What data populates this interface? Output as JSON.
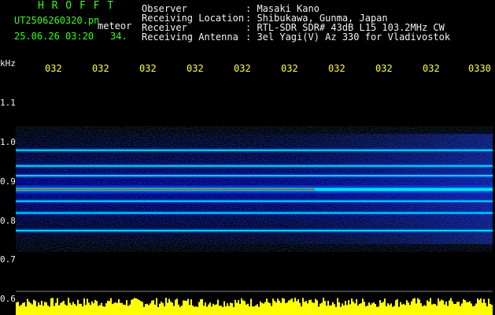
{
  "header": {
    "title": "H R O F F T",
    "filename": "UT2506260320.pn",
    "mode": "meteor",
    "datetime": "25.06.26 03:20",
    "value": "34.",
    "fields": [
      {
        "label": "Observer",
        "value": ": Masaki Kano"
      },
      {
        "label": "Receiving Location",
        "value": ": Shibukawa, Gunma, Japan"
      },
      {
        "label": "Receiver",
        "value": ": RTL-SDR SDR# 43dB L15 103.2MHz CW"
      },
      {
        "label": "Receiving Antenna",
        "value": ": 3el Yagi(V) Az 330 for Vladivostok"
      }
    ]
  },
  "y_axis": {
    "unit": "kHz",
    "ticks": [
      "1.1",
      "1.0",
      "0.9",
      "0.8",
      "0.7",
      "0.6"
    ]
  },
  "x_axis": {
    "ticks": [
      "032",
      "032",
      "032",
      "032",
      "032",
      "032",
      "032",
      "032",
      "032",
      "0330"
    ]
  },
  "colors": {
    "background": "#000000",
    "spectrogram_base": "#000080",
    "signal_line": "#00ffff",
    "strong_signal": "#ff2020",
    "noise_bar": "#ffff00",
    "axis_text": "#ffff33",
    "header_green": "#39ff14",
    "header_white": "#f2f2f2"
  },
  "chart_data": {
    "type": "heatmap",
    "ylabel": "kHz",
    "ylim": [
      0.6,
      1.1
    ],
    "carrier_lines_khz": [
      0.98,
      0.94,
      0.915,
      0.88,
      0.85,
      0.82,
      0.775
    ],
    "strongest_line_khz": 0.88
  }
}
